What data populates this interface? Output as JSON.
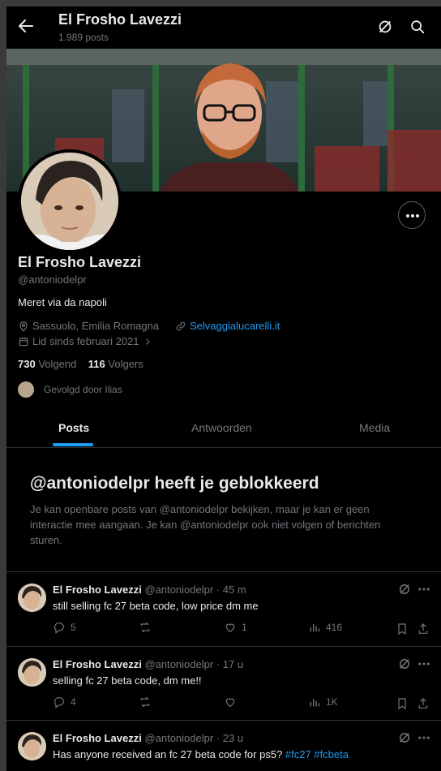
{
  "header": {
    "title": "El Frosho Lavezzi",
    "post_count": "1.989 posts"
  },
  "profile": {
    "name": "El Frosho Lavezzi",
    "handle": "@antoniodelpr",
    "bio": "Meret via da napoli",
    "location": "Sassuolo, Emilia Romagna",
    "website": "Selvaggialucarelli.it",
    "joined": "Lid sinds februari 2021",
    "following_count": "730",
    "following_label": "Volgend",
    "followers_count": "116",
    "followers_label": "Volgers",
    "followed_by": "Gevolgd door Ilias"
  },
  "tabs": [
    {
      "label": "Posts",
      "active": true
    },
    {
      "label": "Antwoorden",
      "active": false
    },
    {
      "label": "Media",
      "active": false
    }
  ],
  "blocked": {
    "title": "@antoniodelpr heeft je geblokkeerd",
    "text": "Je kan openbare posts van @antoniodelpr bekijken, maar je kan er geen interactie mee aangaan. Je kan @antoniodelpr ook niet volgen of berichten sturen."
  },
  "tweets": [
    {
      "name": "El Frosho Lavezzi",
      "handle": "@antoniodelpr",
      "sep": " · ",
      "time": "45 m",
      "text": "still selling fc 27 beta code, low price dm me",
      "tags": "",
      "replies": "5",
      "reposts": "",
      "likes": "1",
      "views": "416"
    },
    {
      "name": "El Frosho Lavezzi",
      "handle": "@antoniodelpr",
      "sep": " · ",
      "time": "17 u",
      "text": "selling fc 27 beta code, dm me!!",
      "tags": "",
      "replies": "4",
      "reposts": "",
      "likes": "",
      "views": "1K"
    },
    {
      "name": "El Frosho Lavezzi",
      "handle": "@antoniodelpr",
      "sep": " · ",
      "time": "23 u",
      "text": "Has anyone received an fc 27 beta code for ps5? ",
      "tags": "#fc27 #fcbeta",
      "replies": "",
      "reposts": "",
      "likes": "",
      "views": ""
    }
  ],
  "colors": {
    "accent": "#1d9bf0",
    "muted": "#71767b",
    "border": "#2f3336",
    "background": "#000000"
  }
}
